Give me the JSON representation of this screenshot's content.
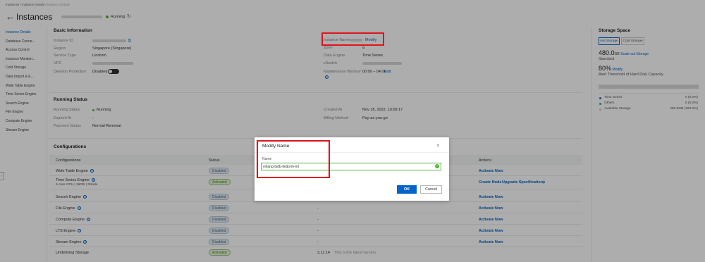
{
  "breadcrumb": [
    "Instances",
    "Instance Details",
    "Instance Details"
  ],
  "header": {
    "title": "Instances",
    "status": "Running"
  },
  "sidebar": {
    "items": [
      "Instance Details",
      "Database Conne...",
      "Access Control",
      "Instance Monitori...",
      "Cold Storage",
      "Data Import & E...",
      "Wide Table Engine",
      "Time Series Engine",
      "Search Engine",
      "File Engine",
      "Compute Engine",
      "Stream Engine"
    ],
    "active_index": 0
  },
  "basic": {
    "section_title": "Basic Information",
    "left": [
      {
        "label": "Instance ID",
        "value": ""
      },
      {
        "label": "Region",
        "value": "Singapore (Singapore)"
      },
      {
        "label": "Service Type",
        "value": "Lindorm"
      },
      {
        "label": "VPC",
        "value": ""
      },
      {
        "label": "Deletion Protection",
        "value": "Disabled"
      }
    ],
    "right": [
      {
        "label": "Instance Name",
        "value": "",
        "action": "Modify"
      },
      {
        "label": "Zone",
        "value": "a"
      },
      {
        "label": "Data Engine",
        "value": "Time Series"
      },
      {
        "label": "vSwitch",
        "value": ""
      },
      {
        "label": "Maintenance Window",
        "value": "00:00 – 04:00",
        "action": "Edit"
      }
    ]
  },
  "running": {
    "section_title": "Running Status",
    "left": [
      {
        "label": "Running Status",
        "value": "Running"
      },
      {
        "label": "Expired At",
        "value": "-"
      },
      {
        "label": "Payment Status",
        "value": "Normal Renewal"
      }
    ],
    "right": [
      {
        "label": "Created At",
        "value": "Nov 18, 2022, 10:09:17"
      },
      {
        "label": "Billing Method",
        "value": "Pay-as-you-go"
      }
    ]
  },
  "configurations": {
    "section_title": "Configurations",
    "columns": [
      "Configurations",
      "Status",
      "Actions"
    ],
    "rows": [
      {
        "name": "Wide Table Engine",
        "sub": "",
        "status": "Disabled",
        "status_type": "disabled",
        "mid": "",
        "actions": [
          "Activate Now"
        ]
      },
      {
        "name": "Time Series Engine",
        "sub": "4-core CPU | 16GB | 2Node",
        "status": "Activated",
        "status_type": "activated",
        "mid": "",
        "actions": [
          "Create Node",
          "Upgrade Specifications"
        ]
      },
      {
        "name": "Search Engine",
        "sub": "",
        "status": "Disabled",
        "status_type": "disabled",
        "mid": "-",
        "actions": [
          "Activate Now"
        ]
      },
      {
        "name": "File Engine",
        "sub": "",
        "status": "Disabled",
        "status_type": "disabled",
        "mid": "-",
        "actions": [
          "Activate Now"
        ]
      },
      {
        "name": "Compute Engine",
        "sub": "",
        "status": "Disabled",
        "status_type": "disabled",
        "mid": "-",
        "actions": [
          "Activate Now"
        ]
      },
      {
        "name": "LTS Engine",
        "sub": "",
        "status": "Disabled",
        "status_type": "disabled",
        "mid": "-",
        "actions": [
          "Activate Now"
        ]
      },
      {
        "name": "Stream Engine",
        "sub": "",
        "status": "Disabled",
        "status_type": "disabled",
        "mid": "-",
        "actions": [
          "Activate Now"
        ]
      },
      {
        "name": "Underlying Storage",
        "sub": "",
        "status": "Activated",
        "status_type": "activated",
        "mid": "3.11.14",
        "mid_note": "This is the latest version.",
        "actions": []
      }
    ]
  },
  "storage": {
    "title": "Storage Space",
    "tabs": [
      "Hot Storage",
      "Cold Storage"
    ],
    "active_tab": 0,
    "capacity": "480.0",
    "capacity_unit": "GB",
    "scale_link": "Scale out Storage",
    "tier": "Standard",
    "threshold": "80%",
    "threshold_link": "Modify",
    "threshold_caption": "Alert Threshold of Hard Disk Capacity",
    "legend": [
      {
        "label": "Time Series",
        "value": "0 (0.0%)",
        "color": "#1e6fd9"
      },
      {
        "label": "Others",
        "value": "0 (0.0%)",
        "color": "#33a0a0"
      },
      {
        "label": "Available Storage",
        "value": "480.0GB (100.0%)",
        "color": "#cccccc"
      }
    ]
  },
  "modal": {
    "title": "Modify Name",
    "field_label": "Name",
    "field_value": "yihang-tsdb-lindorm-ml",
    "ok": "OK",
    "cancel": "Cancel"
  },
  "colors": {
    "accent": "#0064c8",
    "highlight": "#e0141e",
    "success": "#52b035"
  }
}
